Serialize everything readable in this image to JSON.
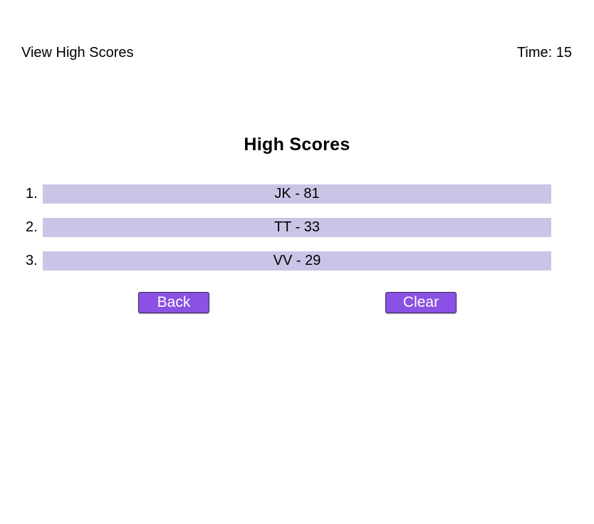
{
  "header": {
    "view_high_scores_label": "View High Scores",
    "timer_text": "Time: 15"
  },
  "main": {
    "title": "High Scores",
    "scores": [
      {
        "rank": "1.",
        "entry": "JK - 81"
      },
      {
        "rank": "2.",
        "entry": "TT - 33"
      },
      {
        "rank": "3.",
        "entry": "VV - 29"
      }
    ],
    "back_label": "Back",
    "clear_label": "Clear"
  },
  "colors": {
    "score_bar": "#cbc4e6",
    "button_bg": "#8a51e4",
    "button_text": "#ffffff"
  }
}
